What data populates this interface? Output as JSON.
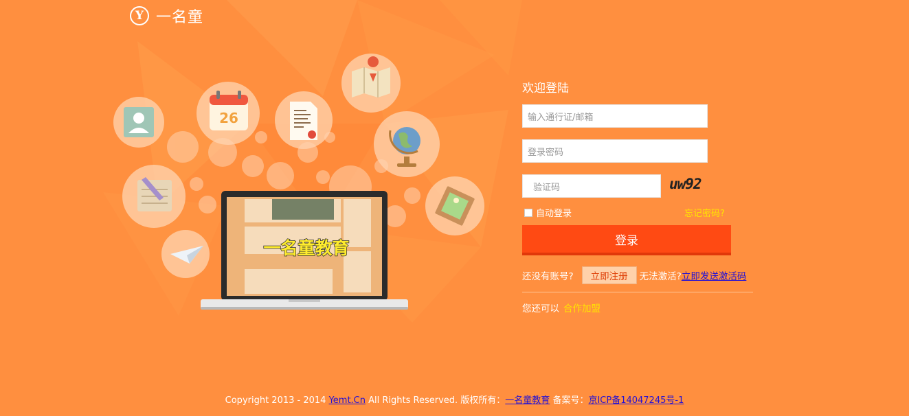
{
  "brand": {
    "logo_letter": "Y",
    "name": "一名童"
  },
  "illustration": {
    "screen_banner": "一名童教育",
    "calendar_day": "26"
  },
  "login": {
    "title": "欢迎登陆",
    "username_placeholder": "输入通行证/邮箱",
    "password_placeholder": "登录密码",
    "captcha_placeholder": "验证码",
    "captcha_text": "uw92",
    "remember_label": "自动登录",
    "forgot_label": "忘记密码?",
    "submit_label": "登录",
    "no_account_text": "还没有账号?",
    "register_label": "立即注册",
    "cannot_activate_text": "无法激活?",
    "send_activation_label": "立即发送激活码",
    "partner_prefix": "您还可以",
    "partner_label": "合作加盟"
  },
  "footer": {
    "copyright": "Copyright 2013 - 2014 ",
    "site_link": "Yemt.Cn",
    "rights": " All Rights Reserved. 版权所有：",
    "owner_link": "一名童教育",
    "icp_prefix": " 备案号：",
    "icp_link": "京ICP备14047245号-1"
  },
  "colors": {
    "background": "#ff8f3f",
    "login_button": "#ff4a13",
    "highlight_text": "#ffe400",
    "link_blue": "#2210d6"
  }
}
